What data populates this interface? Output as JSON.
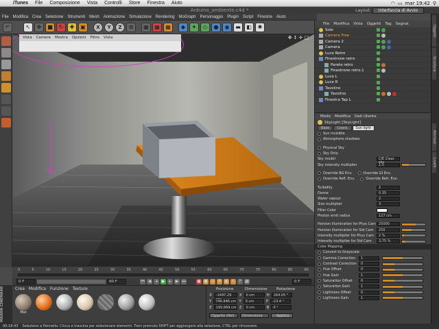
{
  "macos": {
    "app_name": "iTunes",
    "menu": [
      "File",
      "Composizione",
      "Vista",
      "Controlli",
      "Store",
      "Finestra",
      "Aiuto"
    ],
    "clock": "mar 19:42"
  },
  "window": {
    "title": "Arduino_ambiente.c4d *",
    "layout_label": "Layout:",
    "layout_value": "Interfaccia di Avvio"
  },
  "c4d_menu": [
    "File",
    "Modifica",
    "Crea",
    "Selezione",
    "Strumenti",
    "Mesh",
    "Animazione",
    "Simulazione",
    "Rendering",
    "MoGraph",
    "Personaggio",
    "Plugin",
    "Script",
    "Finestre",
    "Aiuto"
  ],
  "viewport": {
    "menu": [
      "Vista",
      "Camere",
      "Mostra",
      "Opzioni",
      "Filtro",
      "Vista"
    ],
    "annotation_color": "#d040c0"
  },
  "timeline": {
    "ticks": [
      "0",
      "5",
      "10",
      "15",
      "20",
      "25",
      "30",
      "35",
      "40",
      "45",
      "50",
      "55",
      "60",
      "65",
      "70",
      "75",
      "80",
      "85",
      "90"
    ],
    "start": "0 F",
    "end": "90 F",
    "current": "0 F"
  },
  "materials": {
    "menu": [
      "Crea",
      "Modifica",
      "Funzione",
      "Texture"
    ],
    "items": [
      {
        "name": "Mat",
        "color": "#8a7a6a"
      },
      {
        "name": "",
        "color": "#e07020"
      },
      {
        "name": "",
        "color": "#b0b0b0"
      },
      {
        "name": "",
        "color": "#d8c8b0"
      },
      {
        "name": "",
        "color": "#6a6a6a"
      },
      {
        "name": "",
        "color": "#a0a0a0"
      },
      {
        "name": "",
        "color": "#c0c0c0"
      }
    ]
  },
  "coordinates": {
    "headers": [
      "Posizione",
      "Dimensione",
      "Rotazione"
    ],
    "rows": [
      {
        "axis": "X",
        "pos": "-1497.29 cm",
        "size": "0 cm",
        "rot_label": "H",
        "rot": "264.05 °"
      },
      {
        "axis": "Y",
        "pos": "746.846 cm",
        "size": "0 cm",
        "rot_label": "P",
        "rot": "-23.4 °"
      },
      {
        "axis": "Z",
        "pos": "195.869 cm",
        "size": "0 cm",
        "rot_label": "B",
        "rot": "0 °"
      }
    ],
    "mode": "Oggetto (Rel)",
    "size_mode": "Dimensione",
    "apply_label": "Applica"
  },
  "status_bar": {
    "time": "00:18:43",
    "message": "Selezione a Pennello: Clicca e trascina per selezionare elementi. Tieni premuto SHIFT per aggiungere alla selezione, CTRL per rimuovere."
  },
  "object_manager": {
    "menu": [
      "File",
      "Modifica",
      "Vista",
      "Oggetti",
      "Tag",
      "Segnal."
    ],
    "objects": [
      {
        "name": "Sole",
        "indent": 0
      },
      {
        "name": "Camera Free",
        "indent": 0
      },
      {
        "name": "Camera 2",
        "indent": 0
      },
      {
        "name": "Camera",
        "indent": 0
      },
      {
        "name": "Luce Retro",
        "indent": 0
      },
      {
        "name": "Finestrone retro",
        "indent": 0
      },
      {
        "name": "Parete retro",
        "indent": 1
      },
      {
        "name": "Finestrone retro.1",
        "indent": 1
      },
      {
        "name": "Luce L",
        "indent": 0
      },
      {
        "name": "Luce R",
        "indent": 0
      },
      {
        "name": "Tavolino",
        "indent": 0
      },
      {
        "name": "Tavolino",
        "indent": 1
      },
      {
        "name": "Finestra Tap L",
        "indent": 0
      }
    ]
  },
  "attributes": {
    "menu": [
      "Modo",
      "Modifica",
      "Dati Utente"
    ],
    "title": "SkyLight [SkyLight]",
    "tabs": [
      "Base",
      "Coord.",
      "Sun light"
    ],
    "active_tab": "Sun light",
    "options": [
      {
        "label": "Sun invisible",
        "type": "radio"
      },
      {
        "label": "Atmosphere shadows",
        "type": "radio"
      },
      {
        "label": "",
        "type": "spacer"
      },
      {
        "label": "Physical Sky",
        "type": "radio"
      },
      {
        "label": "Sky Only",
        "type": "radio"
      },
      {
        "label": "Sky model",
        "type": "field",
        "value": "CIE Clear sky"
      },
      {
        "label": "Sky intensity multiplier",
        "type": "slider",
        "value": "1.5",
        "fill": 0.3
      },
      {
        "label": "",
        "type": "spacer"
      },
      {
        "label": "Override BG Env.",
        "type": "radio2",
        "label2": "Override GI Env."
      },
      {
        "label": "Override Refl. Env.",
        "type": "radio2",
        "label2": "Override Refr. Env."
      },
      {
        "label": "",
        "type": "spacer"
      },
      {
        "label": "Turbidity",
        "type": "field",
        "value": "2"
      },
      {
        "label": "Ozone",
        "type": "field",
        "value": "0.35"
      },
      {
        "label": "Water vapour",
        "type": "field",
        "value": "2"
      },
      {
        "label": "Size multiplier",
        "type": "field",
        "value": "3"
      },
      {
        "label": "Filter Color",
        "type": "color"
      },
      {
        "label": "Photon emit radius",
        "type": "field",
        "value": "127 cm"
      },
      {
        "label": "",
        "type": "spacer"
      },
      {
        "label": "Horizon illumination for Phys Cam",
        "type": "slider",
        "value": "25000",
        "fill": 0.6
      },
      {
        "label": "Horizon illumination for Std Cam",
        "type": "slider",
        "value": "250",
        "fill": 0.4
      },
      {
        "label": "Intensity multiplier for Phys Cam",
        "type": "slider",
        "value": "2 %",
        "fill": 0.1
      },
      {
        "label": "Intensity multiplier for Std Cam",
        "type": "slider",
        "value": "3.75 %",
        "fill": 0.15
      }
    ],
    "color_mapping_title": "Color Mapping",
    "color_mapping": [
      {
        "label": "Convert to Grayscale",
        "type": "radio"
      },
      {
        "label": "Gamma Correction",
        "value": "1",
        "fill": 0.5
      },
      {
        "label": "Contrast Correction",
        "value": "0",
        "fill": 0.3
      },
      {
        "label": "Hue Offset",
        "value": "0",
        "fill": 0.3
      },
      {
        "label": "Hue Gain",
        "value": "1",
        "fill": 0.5
      },
      {
        "label": "Saturation Offset",
        "value": "0",
        "fill": 0.3
      },
      {
        "label": "Saturation Gain",
        "value": "1",
        "fill": 0.5
      },
      {
        "label": "Lightness Offset",
        "value": "0",
        "fill": 0.3
      },
      {
        "label": "Lightness Gain",
        "value": "1",
        "fill": 0.5
      }
    ]
  },
  "right_tabs": [
    "Oggetti",
    "Struttura",
    "Attributi",
    "Livelli"
  ]
}
